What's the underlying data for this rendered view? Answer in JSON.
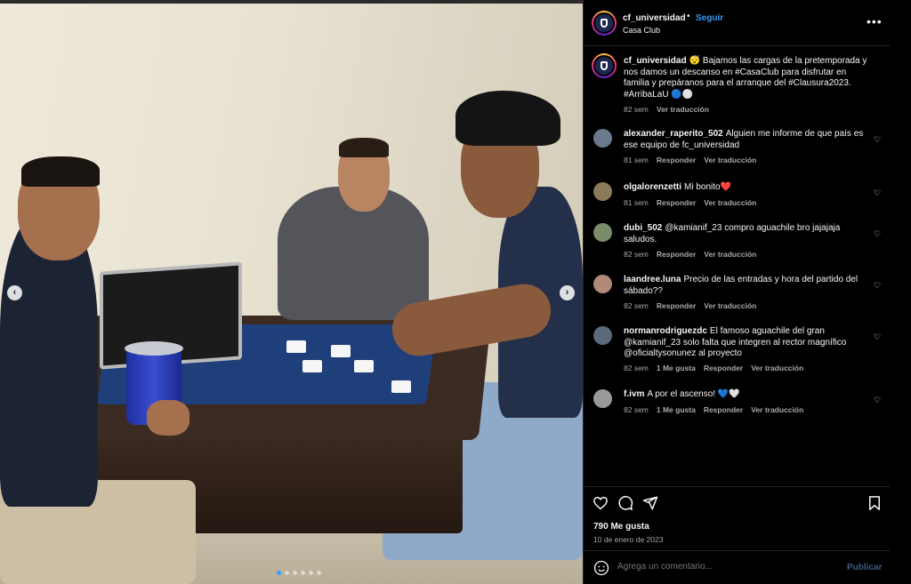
{
  "post": {
    "author": "cf_universidad",
    "follow_label": "Seguir",
    "separator": "•",
    "location": "Casa Club",
    "more_label": "•••",
    "caption": "😴 Bajamos las cargas de la pretemporada y nos damos un descanso en #CasaClub para disfrutar en familia y prepáranos para el arranque del #Clausura2023. #ArribaLaU 🔵⚪",
    "caption_time": "82 sem",
    "caption_translate": "Ver traducción",
    "likes": "790 Me gusta",
    "date": "10 de enero de 2023"
  },
  "carousel": {
    "prev_label": "‹",
    "next_label": "›",
    "dot_count": 6,
    "active_dot": 0
  },
  "comments": [
    {
      "user": "alexander_raperito_502",
      "text": "Alguien me informe de que país es ese equipo de fc_universidad",
      "time": "81 sem",
      "likes": "",
      "reply": "Responder",
      "translate": "Ver traducción"
    },
    {
      "user": "olgalorenzetti",
      "text": "Mi bonito❤️",
      "time": "81 sem",
      "likes": "",
      "reply": "Responder",
      "translate": "Ver traducción"
    },
    {
      "user": "dubi_502",
      "text": "@kamianif_23 compro aguachile bro jajajaja saludos.",
      "time": "82 sem",
      "likes": "",
      "reply": "Responder",
      "translate": "Ver traducción"
    },
    {
      "user": "laandree.luna",
      "text": "Precio de las entradas y hora del partido del sábado??",
      "time": "82 sem",
      "likes": "",
      "reply": "Responder",
      "translate": "Ver traducción"
    },
    {
      "user": "normanrodriguezdc",
      "text": "El famoso aguachile del gran @kamianif_23 solo falta que integren al rector magnífico @oficialtysonunez al proyecto",
      "time": "82 sem",
      "likes": "1 Me gusta",
      "reply": "Responder",
      "translate": "Ver traducción"
    },
    {
      "user": "f.ivm",
      "text": "A por el ascenso! 💙🤍",
      "time": "82 sem",
      "likes": "1 Me gusta",
      "reply": "Responder",
      "translate": "Ver traducción"
    }
  ],
  "composer": {
    "placeholder": "Agrega un comentario...",
    "publish_label": "Publicar"
  },
  "icons": {
    "like": "heart-icon",
    "comment": "comment-icon",
    "share": "send-icon",
    "save": "bookmark-icon",
    "emoji": "emoji-icon",
    "more": "more-icon"
  },
  "colors": {
    "background": "#000000",
    "link": "#3897f0",
    "muted": "#a8a8a8",
    "publish_disabled": "#3d5c85",
    "divider": "#262626"
  }
}
